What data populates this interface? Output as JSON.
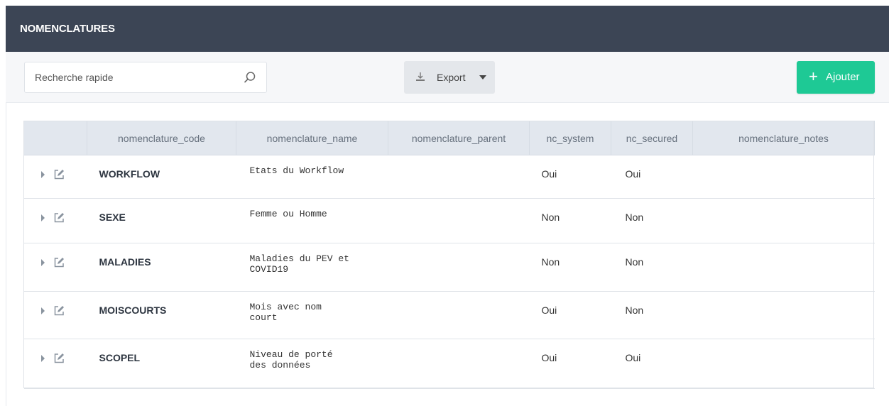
{
  "header": {
    "title": "NOMENCLATURES"
  },
  "toolbar": {
    "search_placeholder": "Recherche rapide",
    "export_label": "Export",
    "add_label": "Ajouter",
    "add_icon": "+"
  },
  "colors": {
    "header_bg": "#3c4555",
    "accent": "#1ec995",
    "table_header_bg": "#e2e7ee"
  },
  "table": {
    "columns": [
      "",
      "nomenclature_code",
      "nomenclature_name",
      "nomenclature_parent",
      "nc_system",
      "nc_secured",
      "nomenclature_notes"
    ],
    "rows": [
      {
        "code": "WORKFLOW",
        "name_lines": [
          "Etats du Workflow"
        ],
        "parent": "",
        "system": "Oui",
        "secured": "Oui",
        "notes": ""
      },
      {
        "code": "SEXE",
        "name_lines": [
          "Femme ou Homme"
        ],
        "parent": "",
        "system": "Non",
        "secured": "Non",
        "notes": ""
      },
      {
        "code": "MALADIES",
        "name_lines": [
          "Maladies du PEV et",
          "COVID19"
        ],
        "parent": "",
        "system": "Non",
        "secured": "Non",
        "notes": ""
      },
      {
        "code": "MOISCOURTS",
        "name_lines": [
          "Mois avec nom",
          "court"
        ],
        "parent": "",
        "system": "Oui",
        "secured": "Non",
        "notes": ""
      },
      {
        "code": "SCOPEL",
        "name_lines": [
          "Niveau de porté",
          "des données"
        ],
        "parent": "",
        "system": "Oui",
        "secured": "Oui",
        "notes": ""
      }
    ]
  }
}
